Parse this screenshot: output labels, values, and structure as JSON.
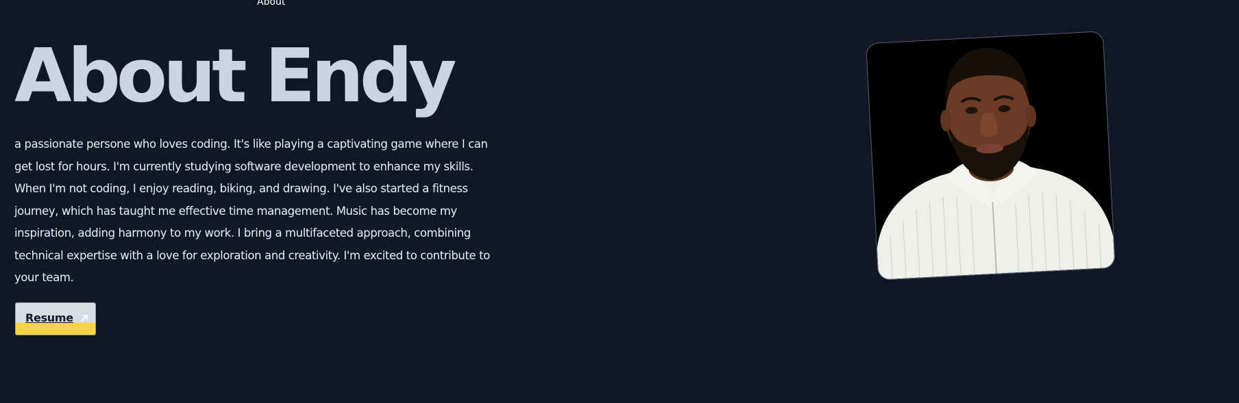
{
  "nav": {
    "about_label": "About"
  },
  "about": {
    "heading": "About Endy",
    "bio": "a passionate persone who loves coding. It's like playing a captivating game where I can get lost for hours. I'm currently studying software development to enhance my skills. When I'm not coding, I enjoy reading, biking, and drawing. I've also started a fitness journey, which has taught me effective time management. Music has become my inspiration, adding harmony to my work. I bring a multifaceted approach, combining technical expertise with a love for exploration and creativity. I'm excited to contribute to your team.",
    "resume_label": "Resume",
    "resume_icon": "arrow-up-right-icon",
    "photo_icon": "profile-photo"
  },
  "colors": {
    "background": "#101828",
    "heading": "#cbd5e2",
    "button_top": "#d8dde5",
    "button_accent": "#f7d548"
  }
}
